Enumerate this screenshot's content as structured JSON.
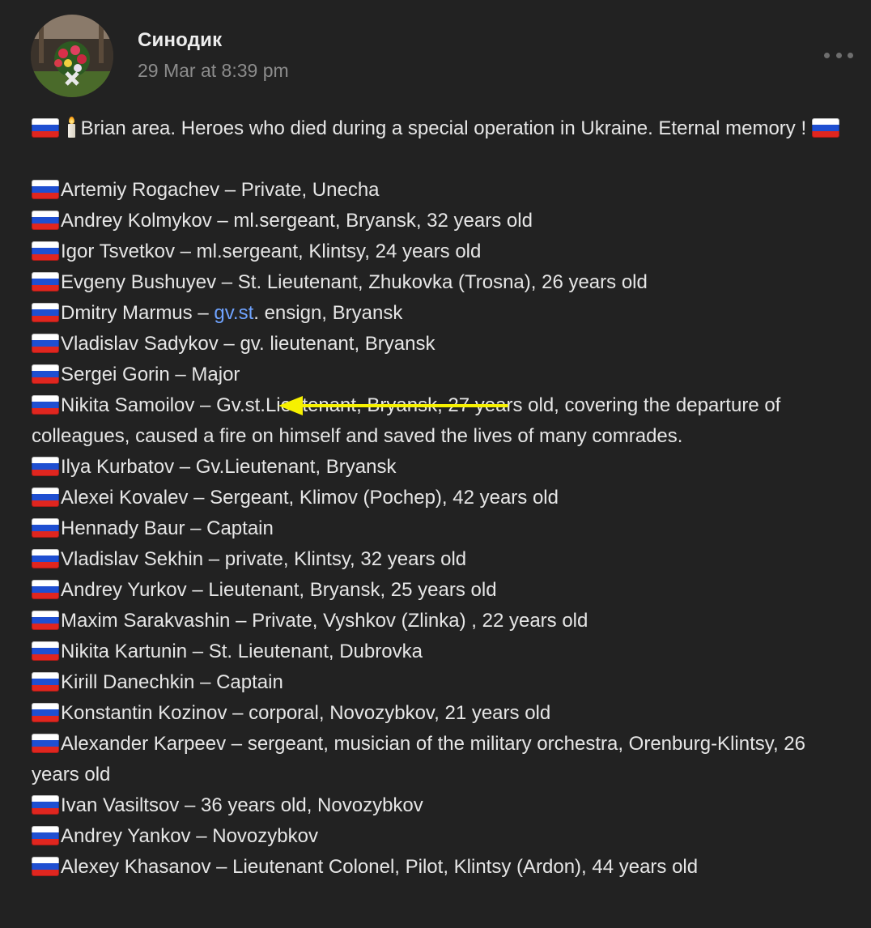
{
  "post": {
    "author": "Синодик",
    "timestamp": "29 Mar at 8:39 pm",
    "more_icon": "more-horizontal-icon",
    "intro": {
      "text": "Brian area. Heroes who died during a special operation in Ukraine. Eternal memory !",
      "prefix_icons": [
        "russian-flag-icon",
        "candle-icon"
      ],
      "suffix_icon": "russian-flag-icon"
    },
    "entries": [
      {
        "text": "Artemiy Rogachev – Private, Unecha"
      },
      {
        "text": "Andrey Kolmykov – ml.sergeant, Bryansk, 32 years old"
      },
      {
        "text": "Igor Tsvetkov – ml.sergeant, Klintsy, 24 years old"
      },
      {
        "text": "Evgeny Bushuyev – St. Lieutenant, Zhukovka (Trosna), 26 years old"
      },
      {
        "before": "Dmitry Marmus – ",
        "link": "gv.st",
        "after": ". ensign, Bryansk"
      },
      {
        "text": "Vladislav Sadykov – gv. lieutenant, Bryansk"
      },
      {
        "text": "Sergei Gorin – Major",
        "highlighted": true
      },
      {
        "text": "Nikita Samoilov – Gv.st.Lieutenant, Bryansk, 27 years old, covering the departure of colleagues, caused a fire on himself and saved the lives of many comrades."
      },
      {
        "text": "Ilya Kurbatov – Gv.Lieutenant, Bryansk"
      },
      {
        "text": "Alexei Kovalev – Sergeant, Klimov (Pochep), 42 years old"
      },
      {
        "text": "Hennady Baur – Captain"
      },
      {
        "text": "Vladislav Sekhin – private, Klintsy, 32 years old"
      },
      {
        "text": "Andrey Yurkov – Lieutenant, Bryansk, 25 years old"
      },
      {
        "text": "Maxim Sarakvashin – Private, Vyshkov (Zlinka) , 22 years old"
      },
      {
        "text": "Nikita Kartunin – St. Lieutenant, Dubrovka"
      },
      {
        "text": "Kirill Danechkin – Captain"
      },
      {
        "text": "Konstantin Kozinov – corporal, Novozybkov, 21 years old"
      },
      {
        "text": "Alexander Karpeev – sergeant, musician of the military orchestra, Orenburg-Klintsy, 26 years old"
      },
      {
        "text": "Ivan Vasiltsov – 36 years old, Novozybkov"
      },
      {
        "text": "Andrey Yankov – Novozybkov"
      },
      {
        "text": "Alexey Khasanov – Lieutenant Colonel, Pilot, Klintsy (Ardon), 44 years old"
      }
    ],
    "entry_icon": "russian-flag-icon",
    "annotation": {
      "icon": "yellow-arrow-icon",
      "color": "#f6f000"
    }
  },
  "colors": {
    "background": "#222222",
    "text": "#e6e6e6",
    "muted": "#8c8c8c",
    "link": "#6fa3ff"
  }
}
